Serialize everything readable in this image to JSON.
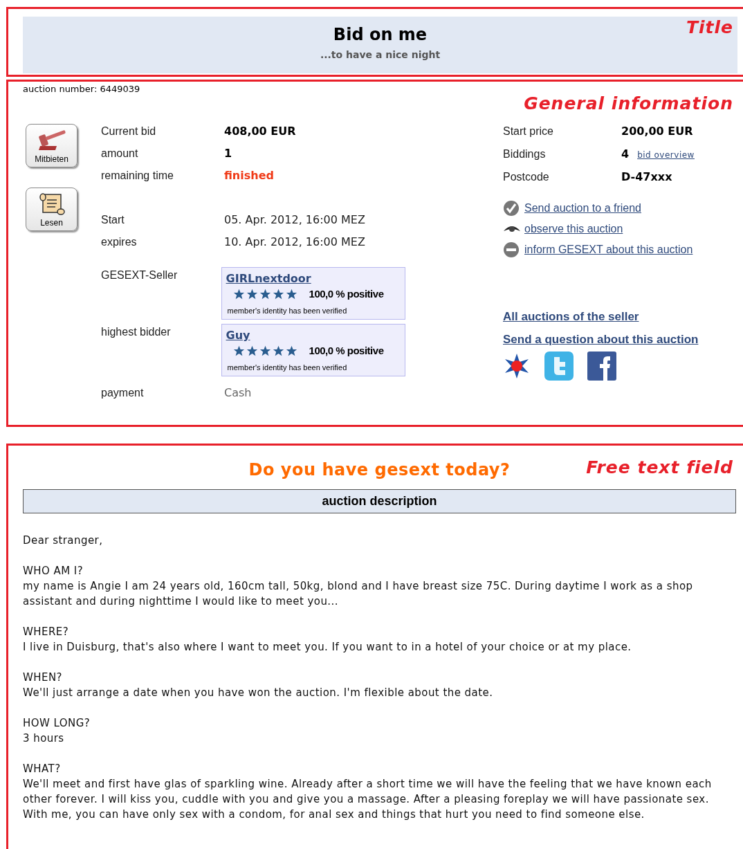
{
  "title": {
    "heading": "Bid on me",
    "subheading": "...to have a nice night",
    "annotation": "Title"
  },
  "general": {
    "auction_number": "auction number: 6449039",
    "annotation": "General information",
    "buttons": [
      {
        "label": "Mitbieten",
        "kind": "gavel"
      },
      {
        "label": "Lesen",
        "kind": "scroll"
      }
    ],
    "detail_groups": [
      {
        "rows": [
          {
            "label": "Current bid",
            "value": "408,00 EUR",
            "kind": "bold"
          },
          {
            "label": "amount",
            "value": "1",
            "kind": "bold"
          },
          {
            "label": "remaining time",
            "value": "finished",
            "kind": "alert"
          }
        ]
      },
      {
        "rows": [
          {
            "label": "Start",
            "value": "05. Apr. 2012, 16:00 MEZ",
            "kind": "plain"
          },
          {
            "label": "expires",
            "value": "10. Apr. 2012, 16:00 MEZ",
            "kind": "plain"
          }
        ]
      },
      {
        "rows": [
          {
            "label": "GESEXT-Seller",
            "kind": "member",
            "member": {
              "name": "GIRLnextdoor",
              "stars": 5,
              "rating": "100,0 % positive",
              "note": "member's identity has been verified"
            }
          },
          {
            "label": "highest bidder",
            "kind": "member",
            "member": {
              "name": "Guy",
              "stars": 5,
              "rating": "100,0 % positive",
              "note": "member's identity has been verified"
            }
          },
          {
            "label": "payment",
            "value": "Cash",
            "kind": "muted"
          }
        ]
      }
    ],
    "facts": [
      {
        "label": "Start price",
        "value": "200,00 EUR"
      },
      {
        "label": "Biddings",
        "value": "4",
        "link": "bid overview"
      },
      {
        "label": "Postcode",
        "value": "D-47xxx"
      }
    ],
    "actions": [
      {
        "label": "Send auction to a friend",
        "kind": "check"
      },
      {
        "label": "observe this auction",
        "kind": "eye"
      },
      {
        "label": "inform GESEXT about this auction",
        "kind": "stop"
      }
    ],
    "links": [
      "All auctions of the seller",
      "Send a question about this auction"
    ]
  },
  "free_text": {
    "headline": "Do you have gesext today?",
    "annotation": "Free text field",
    "bar_title": "auction description",
    "paragraphs": [
      {
        "heading": "Dear stranger,"
      },
      {
        "heading": "WHO AM I?",
        "body": "my name is Angie I am 24 years old, 160cm tall, 50kg, blond and I have breast size 75C. During daytime I work as a shop assistant and during nighttime I would like to meet you..."
      },
      {
        "heading": "WHERE?",
        "body": "I live in Duisburg, that's also where I want to meet you. If you want to in a hotel of your choice or at my place."
      },
      {
        "heading": "WHEN?",
        "body": "We'll just arrange a date when you have won the auction. I'm flexible about the date."
      },
      {
        "heading": "HOW LONG?",
        "body": "3 hours"
      },
      {
        "heading": "WHAT?",
        "body": "We'll meet and first have glas of sparkling wine. Already after a short time we will have the feeling that we have known each other forever. I will kiss you, cuddle with you and give you a massage. After a pleasing foreplay we will have passionate sex. With me, you can have only sex with a condom, for anal sex and things that hurt you need to find someone else."
      }
    ]
  }
}
